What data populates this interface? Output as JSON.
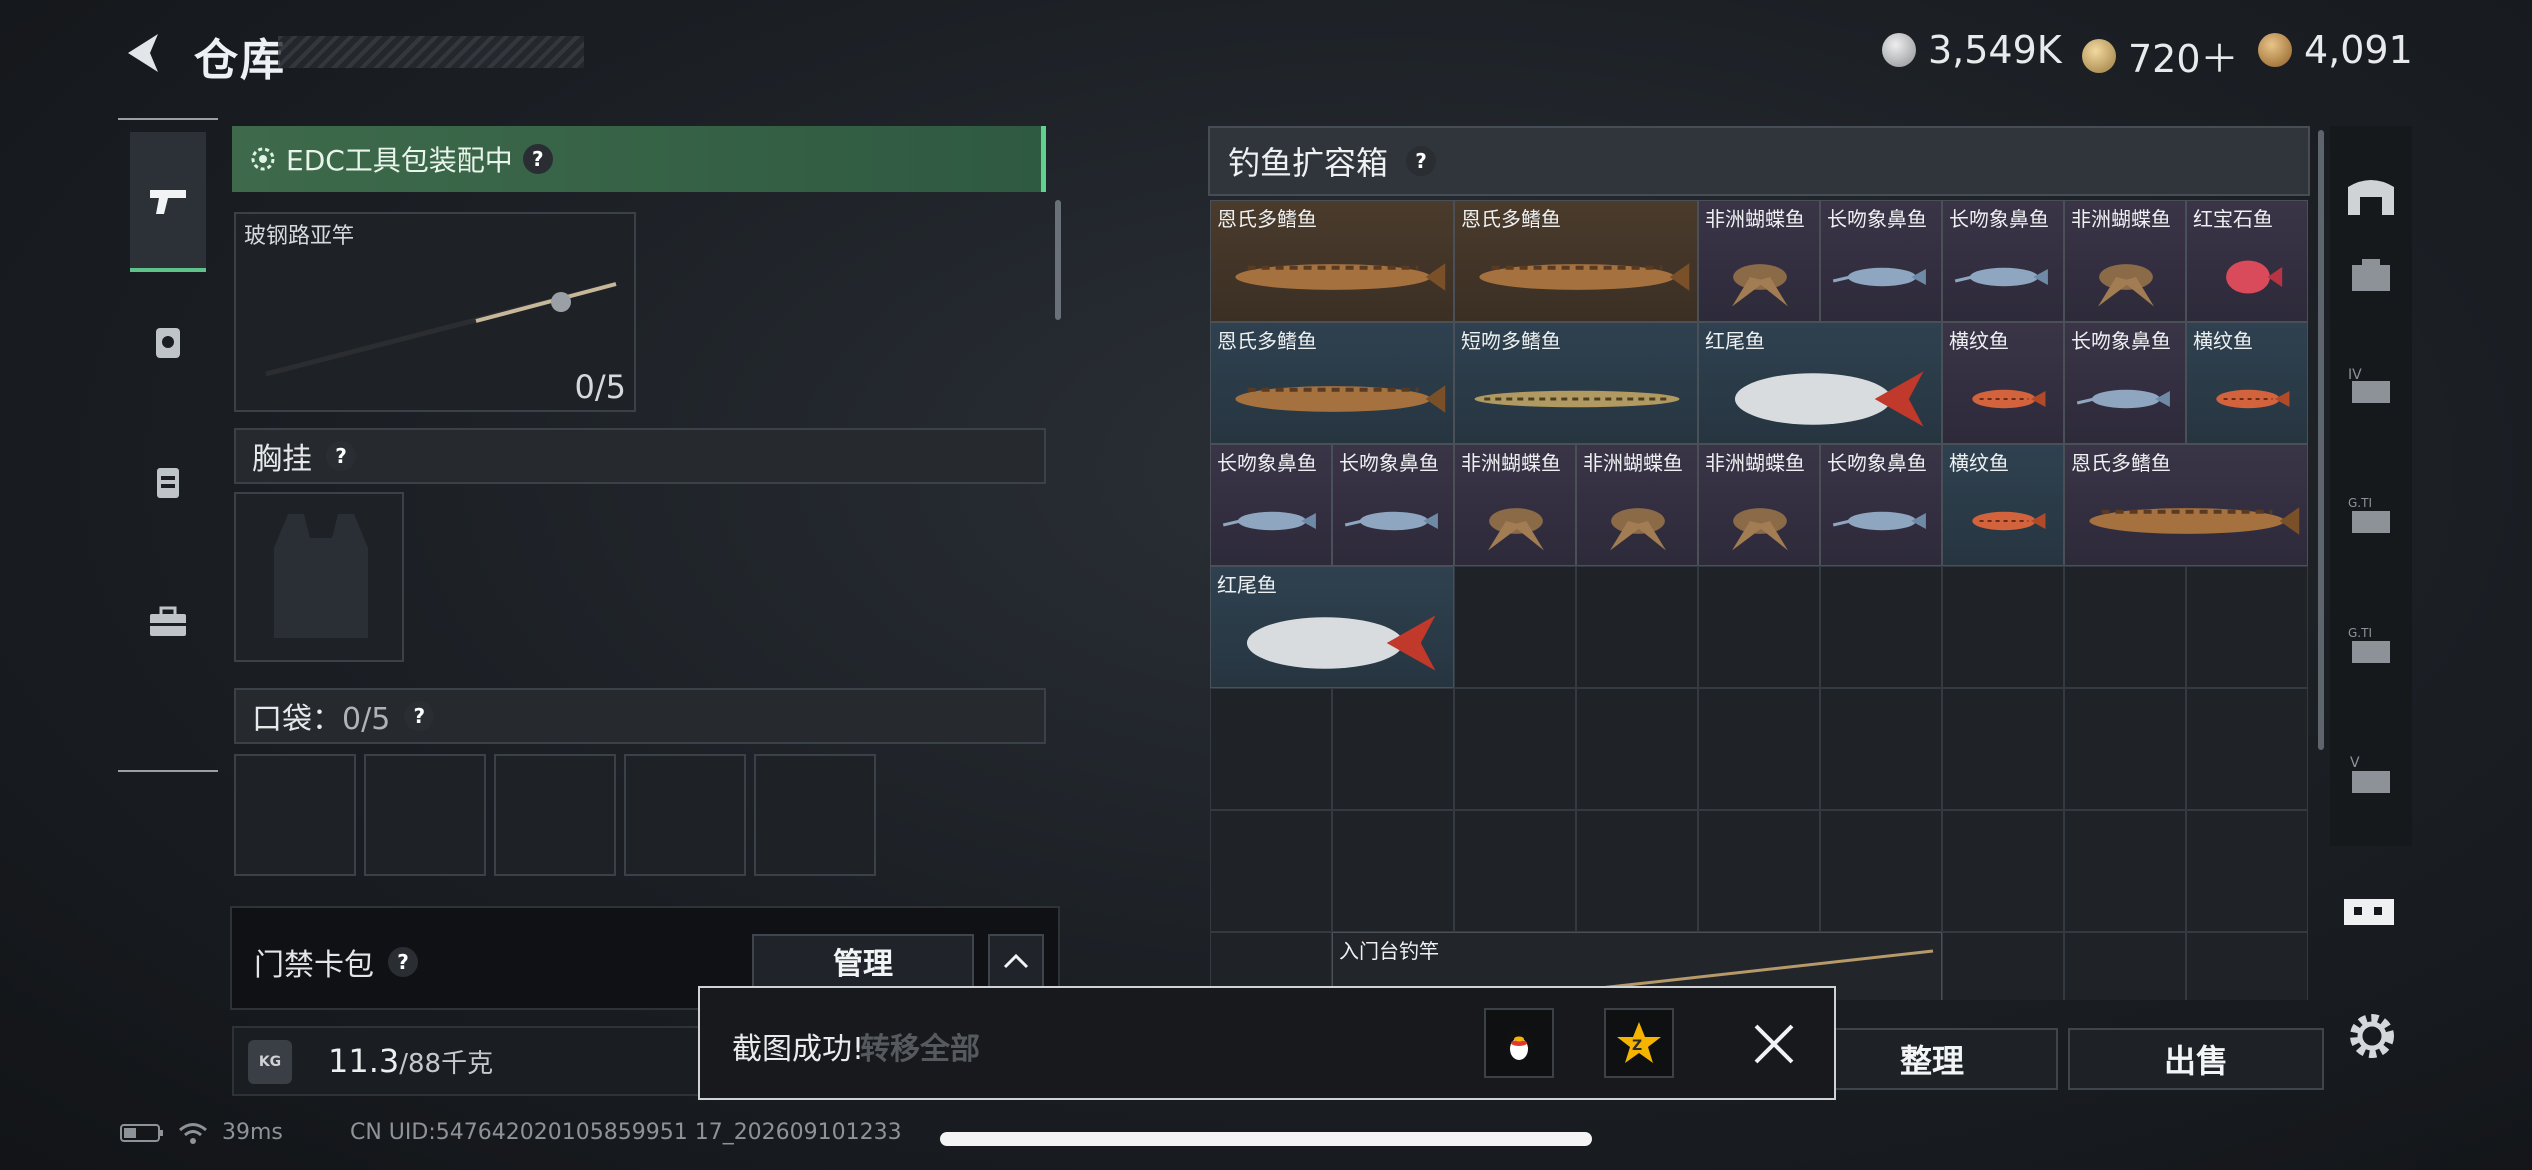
{
  "header": {
    "title": "仓库",
    "currencies": [
      {
        "name": "silver-coin-icon",
        "value": "3,549K"
      },
      {
        "name": "bond-coin-icon",
        "value": "720＋"
      },
      {
        "name": "gold-coin-icon",
        "value": "4,091"
      }
    ]
  },
  "left": {
    "edc_status": "EDC工具包装配中",
    "rod_slot": {
      "label": "玻钢路亚竿",
      "count": "0/5"
    },
    "chest_label": "胸挂",
    "pocket_label": "口袋",
    "pocket_count": "0/5",
    "keycard_label": "门禁卡包",
    "manage_label": "管理",
    "weight_value": "11.3",
    "weight_max": "/88千克",
    "kg_badge": "KG"
  },
  "container": {
    "title": "钓鱼扩容箱",
    "items": [
      {
        "label": "恩氏多鳍鱼",
        "tone": "brown",
        "fish": "eel"
      },
      {
        "label": "恩氏多鳍鱼",
        "tone": "brown",
        "fish": "eel"
      },
      {
        "label": "非洲蝴蝶鱼",
        "tone": "purple",
        "fish": "butterfly"
      },
      {
        "label": "长吻象鼻鱼",
        "tone": "purple",
        "fish": "elephant"
      },
      {
        "label": "长吻象鼻鱼",
        "tone": "purple",
        "fish": "elephant"
      },
      {
        "label": "非洲蝴蝶鱼",
        "tone": "purple",
        "fish": "butterfly"
      },
      {
        "label": "红宝石鱼",
        "tone": "purple",
        "fish": "ruby"
      },
      {
        "label": "恩氏多鳍鱼",
        "tone": "blue",
        "fish": "eel"
      },
      {
        "label": "短吻多鳍鱼",
        "tone": "blue",
        "fish": "longeel"
      },
      {
        "label": "红尾鱼",
        "tone": "blue",
        "fish": "redtail"
      },
      {
        "label": "横纹鱼",
        "tone": "purple",
        "fish": "striped"
      },
      {
        "label": "长吻象鼻鱼",
        "tone": "purple",
        "fish": "elephant"
      },
      {
        "label": "横纹鱼",
        "tone": "blue",
        "fish": "striped"
      },
      {
        "label": "长吻象鼻鱼",
        "tone": "purple",
        "fish": "elephant"
      },
      {
        "label": "长吻象鼻鱼",
        "tone": "purple",
        "fish": "elephant"
      },
      {
        "label": "非洲蝴蝶鱼",
        "tone": "purple",
        "fish": "butterfly"
      },
      {
        "label": "非洲蝴蝶鱼",
        "tone": "purple",
        "fish": "butterfly"
      },
      {
        "label": "非洲蝴蝶鱼",
        "tone": "purple",
        "fish": "butterfly"
      },
      {
        "label": "长吻象鼻鱼",
        "tone": "purple",
        "fish": "elephant"
      },
      {
        "label": "横纹鱼",
        "tone": "blue",
        "fish": "striped"
      },
      {
        "label": "恩氏多鳍鱼",
        "tone": "purple",
        "fish": "eel"
      },
      {
        "label": "红尾鱼",
        "tone": "blue",
        "fish": "redtail"
      }
    ],
    "rod_label": "入门台钓竿"
  },
  "actions": {
    "transfer_all": "转移全部",
    "sort": "整理",
    "sell": "出售"
  },
  "toast": {
    "message": "截图成功!"
  },
  "status": {
    "ping": "39ms",
    "uid": "CN UID:547642020105859951 17_202609101233"
  }
}
